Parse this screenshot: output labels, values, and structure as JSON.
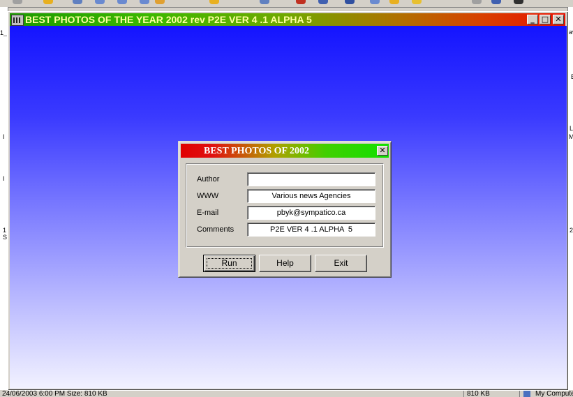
{
  "background": {
    "left_fragments": [
      "1_",
      "I",
      "I",
      "1",
      "S"
    ],
    "right_fragments": [
      "av",
      "E",
      "L",
      "M",
      "2"
    ],
    "statusbar": {
      "left": "24/06/2003 6:00 PM Size: 810 KB",
      "size": "810 KB",
      "location": "My Computer"
    }
  },
  "main_window": {
    "title": "BEST PHOTOS OF THE YEAR 2002 rev  P2E VER 4 .1 ALPHA  5",
    "minimize_label": "_",
    "restore_label": "□",
    "close_label": "✕",
    "gradient_colors": [
      "#1414ff",
      "#f2f2ff"
    ]
  },
  "dialog": {
    "title": "BEST PHOTOS OF 2002",
    "close_label": "✕",
    "fields": [
      {
        "label": "Author",
        "value": ""
      },
      {
        "label": "WWW",
        "value": "Various news Agencies"
      },
      {
        "label": "E-mail",
        "value": "pbyk@sympatico.ca"
      },
      {
        "label": "Comments",
        "value": "P2E VER 4 .1 ALPHA  5"
      }
    ],
    "buttons": {
      "run": "Run",
      "help": "Help",
      "exit": "Exit"
    }
  }
}
